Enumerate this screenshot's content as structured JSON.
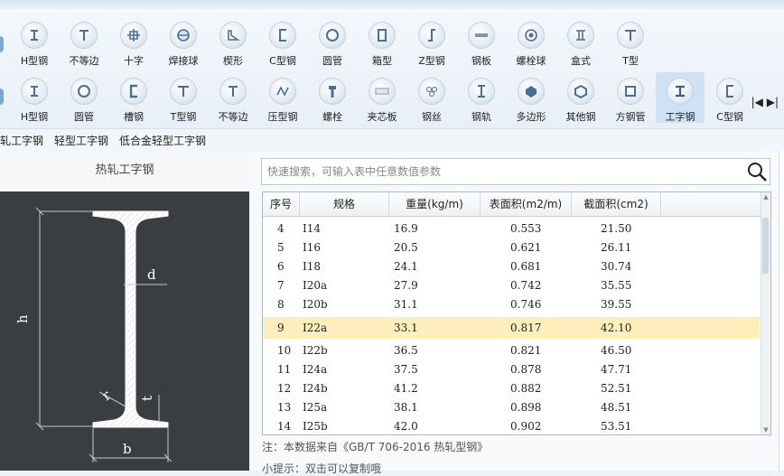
{
  "toolbar": {
    "row1": [
      {
        "label": "H型钢",
        "icon": "h-beam-icon"
      },
      {
        "label": "不等边",
        "icon": "unequal-angle-icon"
      },
      {
        "label": "十字",
        "icon": "cross-icon"
      },
      {
        "label": "焊接球",
        "icon": "welded-ball-icon"
      },
      {
        "label": "楔形",
        "icon": "wedge-icon"
      },
      {
        "label": "C型钢",
        "icon": "c-channel-icon"
      },
      {
        "label": "圆管",
        "icon": "round-pipe-icon"
      },
      {
        "label": "箱型",
        "icon": "box-section-icon"
      },
      {
        "label": "Z型钢",
        "icon": "z-section-icon"
      },
      {
        "label": "钢板",
        "icon": "steel-plate-icon"
      },
      {
        "label": "螺栓球",
        "icon": "bolt-ball-icon"
      },
      {
        "label": "盒式",
        "icon": "box-type-icon"
      },
      {
        "label": "T型",
        "icon": "t-section-icon"
      }
    ],
    "row2": [
      {
        "label": "H型钢",
        "icon": "h-beam-icon"
      },
      {
        "label": "圆管",
        "icon": "round-pipe-icon"
      },
      {
        "label": "槽钢",
        "icon": "channel-icon"
      },
      {
        "label": "T型钢",
        "icon": "t-section-icon"
      },
      {
        "label": "不等边",
        "icon": "unequal-angle-icon"
      },
      {
        "label": "压型钢",
        "icon": "profiled-steel-icon"
      },
      {
        "label": "螺栓",
        "icon": "bolt-icon"
      },
      {
        "label": "夹芯板",
        "icon": "sandwich-panel-icon"
      },
      {
        "label": "钢丝",
        "icon": "steel-wire-icon"
      },
      {
        "label": "钢轨",
        "icon": "rail-icon"
      },
      {
        "label": "多边形",
        "icon": "polygon-icon"
      },
      {
        "label": "其他钢",
        "icon": "other-steel-icon"
      },
      {
        "label": "方钢管",
        "icon": "square-pipe-icon"
      },
      {
        "label": "工字钢",
        "icon": "i-beam-icon"
      },
      {
        "label": "C型钢",
        "icon": "c-channel-icon"
      }
    ],
    "nav_arrows": "|◀ ▶|"
  },
  "sub_tabs": [
    "轧工字钢",
    "轻型工字钢",
    "低合金轻型工字钢"
  ],
  "left_panel": {
    "title": "热轧工字钢",
    "dim_labels": {
      "h": "h",
      "b": "b",
      "d": "d",
      "t": "t",
      "r": "r"
    }
  },
  "search": {
    "placeholder": "快速搜索，可输入表中任意数值参数"
  },
  "table": {
    "headers": [
      "序号",
      "规格",
      "重量(kg/m)",
      "表面积(m2/m)",
      "截面积(cm2)"
    ],
    "rows": [
      [
        "4",
        "I14",
        "16.9",
        "0.553",
        "21.50"
      ],
      [
        "5",
        "I16",
        "20.5",
        "0.621",
        "26.11"
      ],
      [
        "6",
        "I18",
        "24.1",
        "0.681",
        "30.74"
      ],
      [
        "7",
        "I20a",
        "27.9",
        "0.742",
        "35.55"
      ],
      [
        "8",
        "I20b",
        "31.1",
        "0.746",
        "39.55"
      ],
      [
        "9",
        "I22a",
        "33.1",
        "0.817",
        "42.10"
      ],
      [
        "10",
        "I22b",
        "36.5",
        "0.821",
        "46.50"
      ],
      [
        "11",
        "I24a",
        "37.5",
        "0.878",
        "47.71"
      ],
      [
        "12",
        "I24b",
        "41.2",
        "0.882",
        "52.51"
      ],
      [
        "13",
        "I25a",
        "38.1",
        "0.898",
        "48.51"
      ],
      [
        "14",
        "I25b",
        "42.0",
        "0.902",
        "53.51"
      ]
    ],
    "selected_row_index": 5
  },
  "note": "注：本数据来自《GB/T 706-2016 热轧型钢》",
  "tip": "小提示：双击可以复制哦",
  "colors": {
    "accent": "#cfe2f5",
    "highlight": "#fdeebb",
    "diagram_bg": "#3a3d41"
  }
}
